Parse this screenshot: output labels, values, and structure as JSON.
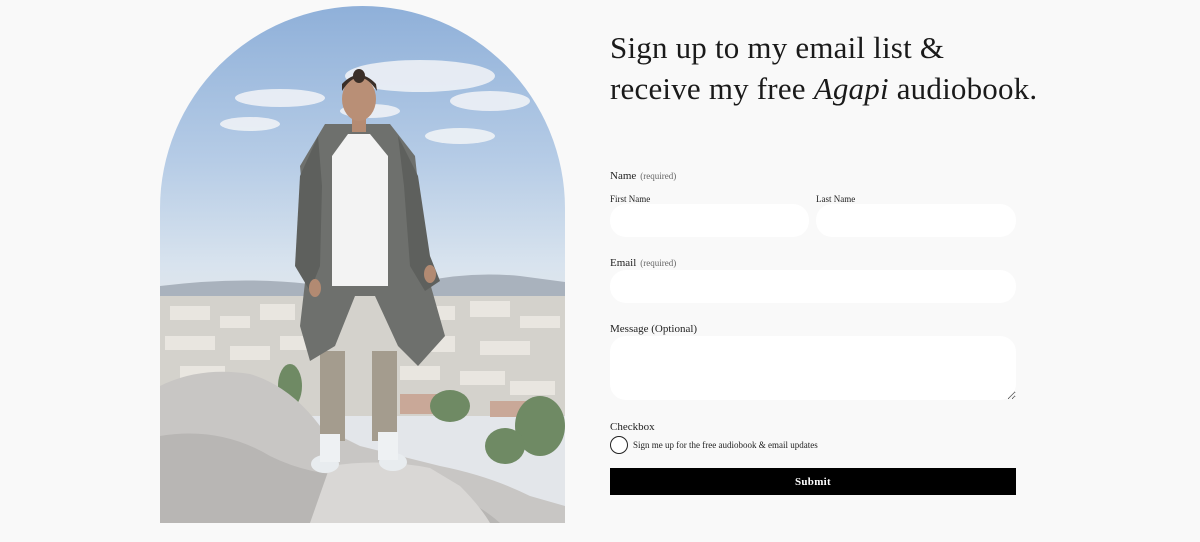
{
  "heading": {
    "line1": "Sign up to my email list &",
    "line2_prefix": "receive my free ",
    "line2_italic": "Agapi",
    "line2_suffix": " audiobook."
  },
  "form": {
    "name_label": "Name",
    "name_required": "(required)",
    "first_name_label": "First Name",
    "last_name_label": "Last Name",
    "first_name_value": "",
    "last_name_value": "",
    "email_label": "Email",
    "email_required": "(required)",
    "email_value": "",
    "message_label": "Message (Optional)",
    "message_value": "",
    "checkbox_section_label": "Checkbox",
    "checkbox_text": "Sign me up for the free audiobook & email updates",
    "checkbox_checked": false,
    "submit_label": "Submit"
  },
  "colors": {
    "background": "#f9f9f9",
    "field_background": "#ffffff",
    "button_background": "#000000",
    "button_text": "#ffffff"
  }
}
